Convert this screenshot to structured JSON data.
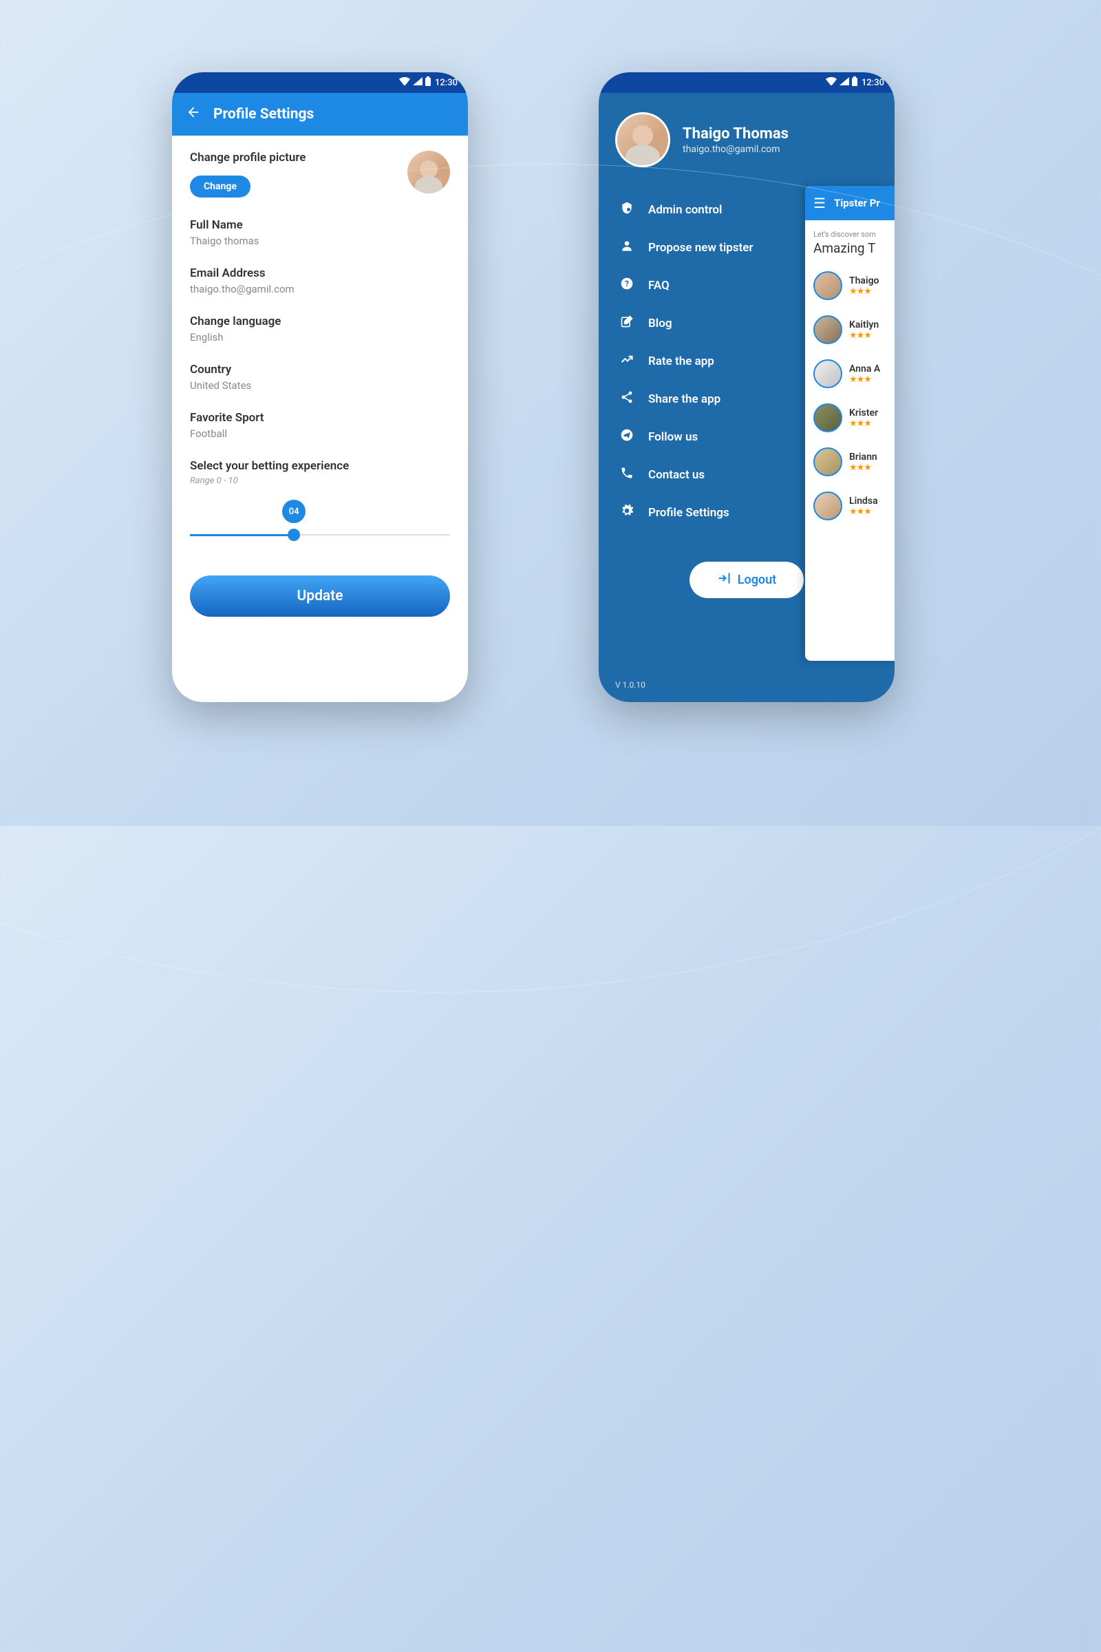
{
  "status": {
    "time": "12:30"
  },
  "settings": {
    "title": "Profile Settings",
    "changePicLabel": "Change profile picture",
    "changeBtn": "Change",
    "fullNameLabel": "Full Name",
    "fullNameValue": "Thaigo thomas",
    "emailLabel": "Email Address",
    "emailValue": "thaigo.tho@gamil.com",
    "languageLabel": "Change language",
    "languageValue": "English",
    "countryLabel": "Country",
    "countryValue": "United States",
    "sportLabel": "Favorite Sport",
    "sportValue": "Football",
    "sliderLabel": "Select your betting experience",
    "sliderRange": "Range 0 - 10",
    "sliderValue": "04",
    "updateBtn": "Update"
  },
  "drawer": {
    "userName": "Thaigo Thomas",
    "userEmail": "thaigo.tho@gamil.com",
    "items": [
      {
        "icon": "admin",
        "label": "Admin control"
      },
      {
        "icon": "person",
        "label": "Propose new tipster"
      },
      {
        "icon": "help",
        "label": "FAQ"
      },
      {
        "icon": "blog",
        "label": "Blog"
      },
      {
        "icon": "rate",
        "label": "Rate the app"
      },
      {
        "icon": "share",
        "label": "Share the app"
      },
      {
        "icon": "follow",
        "label": "Follow us"
      },
      {
        "icon": "contact",
        "label": "Contact us"
      },
      {
        "icon": "settings",
        "label": "Profile Settings"
      }
    ],
    "logout": "Logout",
    "version": "V 1.0.10"
  },
  "peek": {
    "title": "Tipster Pr",
    "hint": "Let's discover som",
    "heading": "Amazing T",
    "tipsters": [
      {
        "name": "Thaigo"
      },
      {
        "name": "Kaitlyn"
      },
      {
        "name": "Anna A"
      },
      {
        "name": "Krister"
      },
      {
        "name": "Briann"
      },
      {
        "name": "Lindsa"
      }
    ]
  }
}
